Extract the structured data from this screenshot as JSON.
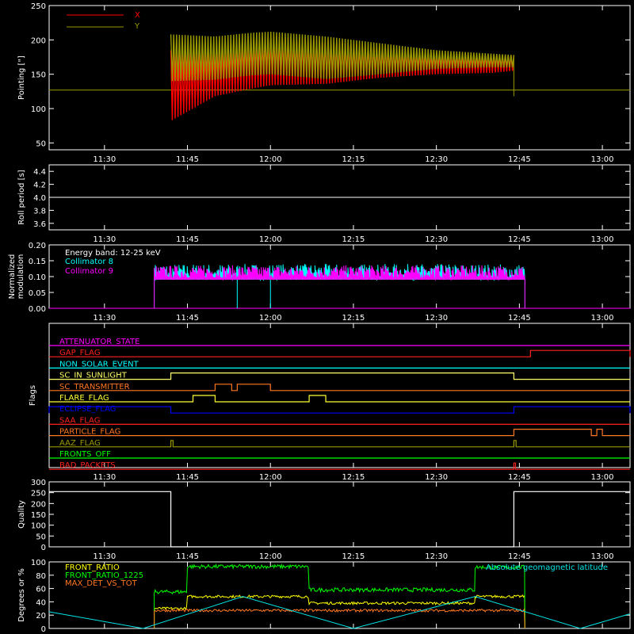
{
  "x_ticks": [
    "11:30",
    "11:45",
    "12:00",
    "12:15",
    "12:30",
    "12:45",
    "13:00"
  ],
  "chart_data": [
    {
      "type": "area",
      "ylabel": "Pointing [\"]",
      "ylim": [
        40,
        250
      ],
      "yticks": [
        "50",
        "100",
        "150",
        "200",
        "250"
      ],
      "legend": [
        {
          "name": "X",
          "color": "#ff0000"
        },
        {
          "name": "Y",
          "color": "#999900"
        }
      ],
      "reference_level": 127,
      "series": [
        {
          "name": "X",
          "color": "#ff0000",
          "time": [
            "11:42",
            "11:50",
            "11:56",
            "12:00",
            "12:10",
            "12:20",
            "12:30",
            "12:40",
            "12:44"
          ],
          "upper": [
            185,
            185,
            200,
            205,
            200,
            190,
            180,
            178,
            178
          ],
          "lower": [
            82,
            118,
            128,
            134,
            136,
            145,
            150,
            152,
            155
          ]
        },
        {
          "name": "Y",
          "color": "#999900",
          "time": [
            "11:42",
            "11:50",
            "11:56",
            "12:00",
            "12:10",
            "12:20",
            "12:30",
            "12:40",
            "12:44"
          ],
          "upper": [
            208,
            205,
            210,
            212,
            205,
            195,
            185,
            180,
            178
          ],
          "lower": [
            140,
            142,
            148,
            150,
            143,
            150,
            158,
            160,
            160
          ]
        }
      ]
    },
    {
      "type": "line",
      "ylabel": "Roll period [s]",
      "ylim": [
        3.5,
        4.5
      ],
      "yticks": [
        "3.6",
        "3.8",
        "4.0",
        "4.2",
        "4.4"
      ],
      "value": 4.0
    },
    {
      "type": "line",
      "ylabel": "Normalized\nmodulation",
      "ylim": [
        0,
        0.2
      ],
      "yticks": [
        "0.00",
        "0.05",
        "0.10",
        "0.15",
        "0.20"
      ],
      "annotation": "Energy band: 12-25 keV",
      "legend": [
        {
          "name": "Collimator 8",
          "color": "#00ffff"
        },
        {
          "name": "Collimator 9",
          "color": "#ff00ff"
        }
      ],
      "start": "11:39",
      "end": "12:46",
      "baseline": 0.09,
      "collimator8_drop": [
        "11:54",
        "12:00"
      ]
    },
    {
      "type": "table",
      "ylabel": "Flags",
      "flags": [
        {
          "name": "ATTENUATOR_STATE",
          "color": "#ff00ff",
          "high": []
        },
        {
          "name": "GAP_FLAG",
          "color": "#ff2020",
          "high": [
            [
              "12:47",
              "13:05"
            ]
          ]
        },
        {
          "name": "NON_SOLAR_EVENT",
          "color": "#00ffff",
          "high": []
        },
        {
          "name": "SC_IN_SUNLIGHT",
          "color": "#ffff66",
          "high": [
            [
              "11:42",
              "12:44"
            ]
          ]
        },
        {
          "name": "SC_TRANSMITTER",
          "color": "#ff7722",
          "high": [
            [
              "11:50",
              "11:53"
            ],
            [
              "11:54",
              "12:00"
            ]
          ]
        },
        {
          "name": "FLARE_FLAG",
          "color": "#ffff33",
          "high": [
            [
              "11:46",
              "11:50"
            ],
            [
              "12:07",
              "12:10"
            ]
          ]
        },
        {
          "name": "ECLIPSE_FLAG",
          "color": "#0000ff",
          "high": [
            [
              "11:20",
              "11:42"
            ],
            [
              "12:44",
              "13:05"
            ]
          ]
        },
        {
          "name": "SAA_FLAG",
          "color": "#ff2020",
          "high": []
        },
        {
          "name": "PARTICLE_FLAG",
          "color": "#ff7722",
          "high": [
            [
              "12:44",
              "12:58"
            ],
            [
              "12:59",
              "13:00"
            ]
          ]
        },
        {
          "name": "AAZ_FLAG",
          "color": "#999900",
          "high": [
            [
              "11:42",
              "11:42.4"
            ],
            [
              "12:44",
              "12:44.4"
            ]
          ]
        },
        {
          "name": "FRONTS_OFF",
          "color": "#00ff00",
          "high": []
        },
        {
          "name": "BAD_PACKETS",
          "color": "#ff2020",
          "high": [
            [
              "12:44",
              "12:44.3"
            ]
          ]
        }
      ]
    },
    {
      "type": "line",
      "ylabel": "Quality",
      "ylim": [
        0,
        300
      ],
      "yticks": [
        "0",
        "50",
        "100",
        "150",
        "200",
        "250",
        "300"
      ],
      "segments": [
        {
          "from": "11:20",
          "to": "11:42",
          "value": 255
        },
        {
          "from": "11:42",
          "to": "12:44",
          "value": 0
        },
        {
          "from": "12:44",
          "to": "13:05",
          "value": 255
        }
      ]
    },
    {
      "type": "line",
      "ylabel": "Degrees or %",
      "ylim": [
        0,
        100
      ],
      "yticks": [
        "0",
        "20",
        "40",
        "60",
        "80",
        "100"
      ],
      "annotation": "Absolute geomagnetic latitude",
      "legend": [
        {
          "name": "FRONT_RATIO",
          "color": "#ffff00"
        },
        {
          "name": "FRONT_RATIO_1225",
          "color": "#00ff00"
        },
        {
          "name": "MAX_DET_VS_TOT",
          "color": "#ff7722"
        }
      ],
      "series": [
        {
          "name": "FRONT_RATIO",
          "color": "#ffff00",
          "segments": [
            [
              "11:39",
              "11:45",
              30
            ],
            [
              "11:45",
              "12:07",
              48
            ],
            [
              "12:07",
              "12:37",
              38
            ],
            [
              "12:37",
              "12:46",
              48
            ]
          ]
        },
        {
          "name": "FRONT_RATIO_1225",
          "color": "#00ff00",
          "segments": [
            [
              "11:39",
              "11:45",
              55
            ],
            [
              "11:45",
              "12:07",
              93
            ],
            [
              "12:07",
              "12:37",
              58
            ],
            [
              "12:37",
              "12:46",
              92
            ]
          ]
        },
        {
          "name": "MAX_DET_VS_TOT",
          "color": "#ff7722",
          "segments": [
            [
              "11:39",
              "12:46",
              27
            ]
          ]
        },
        {
          "name": "Absolute geomagnetic latitude",
          "color": "#00e5e5",
          "points": [
            [
              "11:20",
              25
            ],
            [
              "11:37",
              0
            ],
            [
              "11:55",
              48
            ],
            [
              "12:15",
              0
            ],
            [
              "12:37",
              48
            ],
            [
              "12:56",
              0
            ],
            [
              "13:05",
              22
            ]
          ]
        }
      ]
    }
  ]
}
